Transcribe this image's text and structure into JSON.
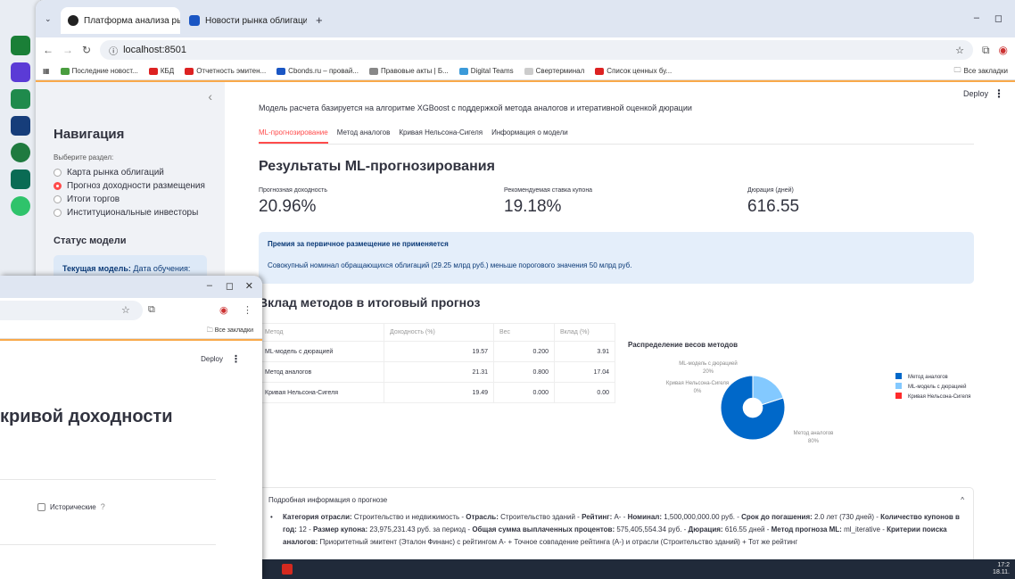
{
  "browser": {
    "tabs": [
      {
        "label": "Платформа анализа рынка об",
        "close": "×"
      },
      {
        "label": "Новости рынка облигаций",
        "close": "×"
      }
    ],
    "new_tab": "+",
    "url": "localhost:8501",
    "bookmarks": [
      "Последние новост...",
      "КБД",
      "Отчетность эмитен...",
      "Cbonds.ru – провай...",
      "Правовые акты | Б...",
      "Digital Teams",
      "Свертерминал",
      "Список ценных бу..."
    ],
    "all_bookmarks": "Все закладки"
  },
  "sidebar": {
    "nav_title": "Навигация",
    "nav_sub": "Выберите раздел:",
    "items": [
      {
        "label": "Карта рынка облигаций",
        "selected": false
      },
      {
        "label": "Прогноз доходности размещения",
        "selected": true
      },
      {
        "label": "Итоги торгов",
        "selected": false
      },
      {
        "label": "Институциональные инвесторы",
        "selected": false
      }
    ],
    "status_title": "Статус модели",
    "status_text_bold": "Текущая модель:",
    "status_text": " Дата обучения:"
  },
  "header": {
    "deploy": "Deploy",
    "menu": "⋮"
  },
  "main": {
    "description": "Модель расчета базируется на алгоритме XGBoost с поддержкой метода аналогов и итеративной оценкой дюрации",
    "tabs": [
      "ML-прогнозирование",
      "Метод аналогов",
      "Кривая Нельсона-Сигеля",
      "Информация о модели"
    ],
    "title": "Результаты ML-прогнозирования",
    "metrics": [
      {
        "label": "Прогнозная доходность",
        "value": "20.96%"
      },
      {
        "label": "Рекомендуемая ставка купона",
        "value": "19.18%"
      },
      {
        "label": "Дюрация (дней)",
        "value": "616.55"
      }
    ],
    "alert_title": "Премия за первичное размещение не применяется",
    "alert_text": "Совокупный номинал обращающихся облигаций (29.25 млрд руб.) меньше порогового значения 50 млрд руб.",
    "contrib_title": "Вклад методов в итоговый прогноз",
    "table": {
      "headers": [
        "Метод",
        "Доходность (%)",
        "Вес",
        "Вклад (%)"
      ],
      "rows": [
        [
          "ML-модель с дюрацией",
          "19.57",
          "0.200",
          "3.91"
        ],
        [
          "Метод аналогов",
          "21.31",
          "0.800",
          "17.04"
        ],
        [
          "Кривая Нельсона-Сигеля",
          "19.49",
          "0.000",
          "0.00"
        ]
      ]
    },
    "expander_title": "Подробная информация о прогнозе",
    "expander_icon": "^",
    "details": [
      {
        "k": "Категория отрасли:",
        "v": " Строительство и недвижимость - "
      },
      {
        "k": "Отрасль:",
        "v": " Строительство зданий - "
      },
      {
        "k": "Рейтинг:",
        "v": " A- - "
      },
      {
        "k": "Номинал:",
        "v": " 1,500,000,000.00 руб. - "
      },
      {
        "k": "Срок до погашения:",
        "v": " 2.0 лет (730 дней) - "
      },
      {
        "k": "Количество купонов в год:",
        "v": " 12 - "
      },
      {
        "k": "Размер купона:",
        "v": " 23,975,231.43 руб. за период - "
      },
      {
        "k": "Общая сумма выплаченных процентов:",
        "v": " 575,405,554.34 руб. - "
      },
      {
        "k": "Дюрация:",
        "v": " 616.55 дней - "
      },
      {
        "k": "Метод прогноза ML:",
        "v": " ml_iterative - "
      },
      {
        "k": "Критерии поиска аналогов:",
        "v": " Приоритетный эмитент (Эталон Финанс) с рейтингом A- + Точное совпадение рейтинга (A-) и отрасли (Строительство зданий) + Тот же рейтинг"
      }
    ]
  },
  "chart_data": {
    "type": "pie",
    "title": "Распределение весов методов",
    "hole": 0.3,
    "slices": [
      {
        "label": "Метод аналогов",
        "value": 80,
        "color": "#0068c9"
      },
      {
        "label": "ML-модель с дюрацией",
        "value": 20,
        "color": "#83c9ff"
      },
      {
        "label": "Кривая Нельсона-Сигеля",
        "value": 0,
        "color": "#ff2b2b"
      }
    ],
    "slice_labels": [
      "80%",
      "20%",
      "0%"
    ],
    "legend": [
      "Метод аналогов",
      "ML-модель с дюрацией",
      "Кривая Нельсона-Сигеля"
    ],
    "legend_position": "right"
  },
  "taskbar": {
    "time": "17:2",
    "date": "18.11."
  },
  "overlay": {
    "min": "–",
    "max": "◻",
    "close": "✕",
    "deploy": "Deploy",
    "title": "кривой доходности",
    "checkbox_label": "Исторические",
    "all_bookmarks": "Все закладки"
  }
}
